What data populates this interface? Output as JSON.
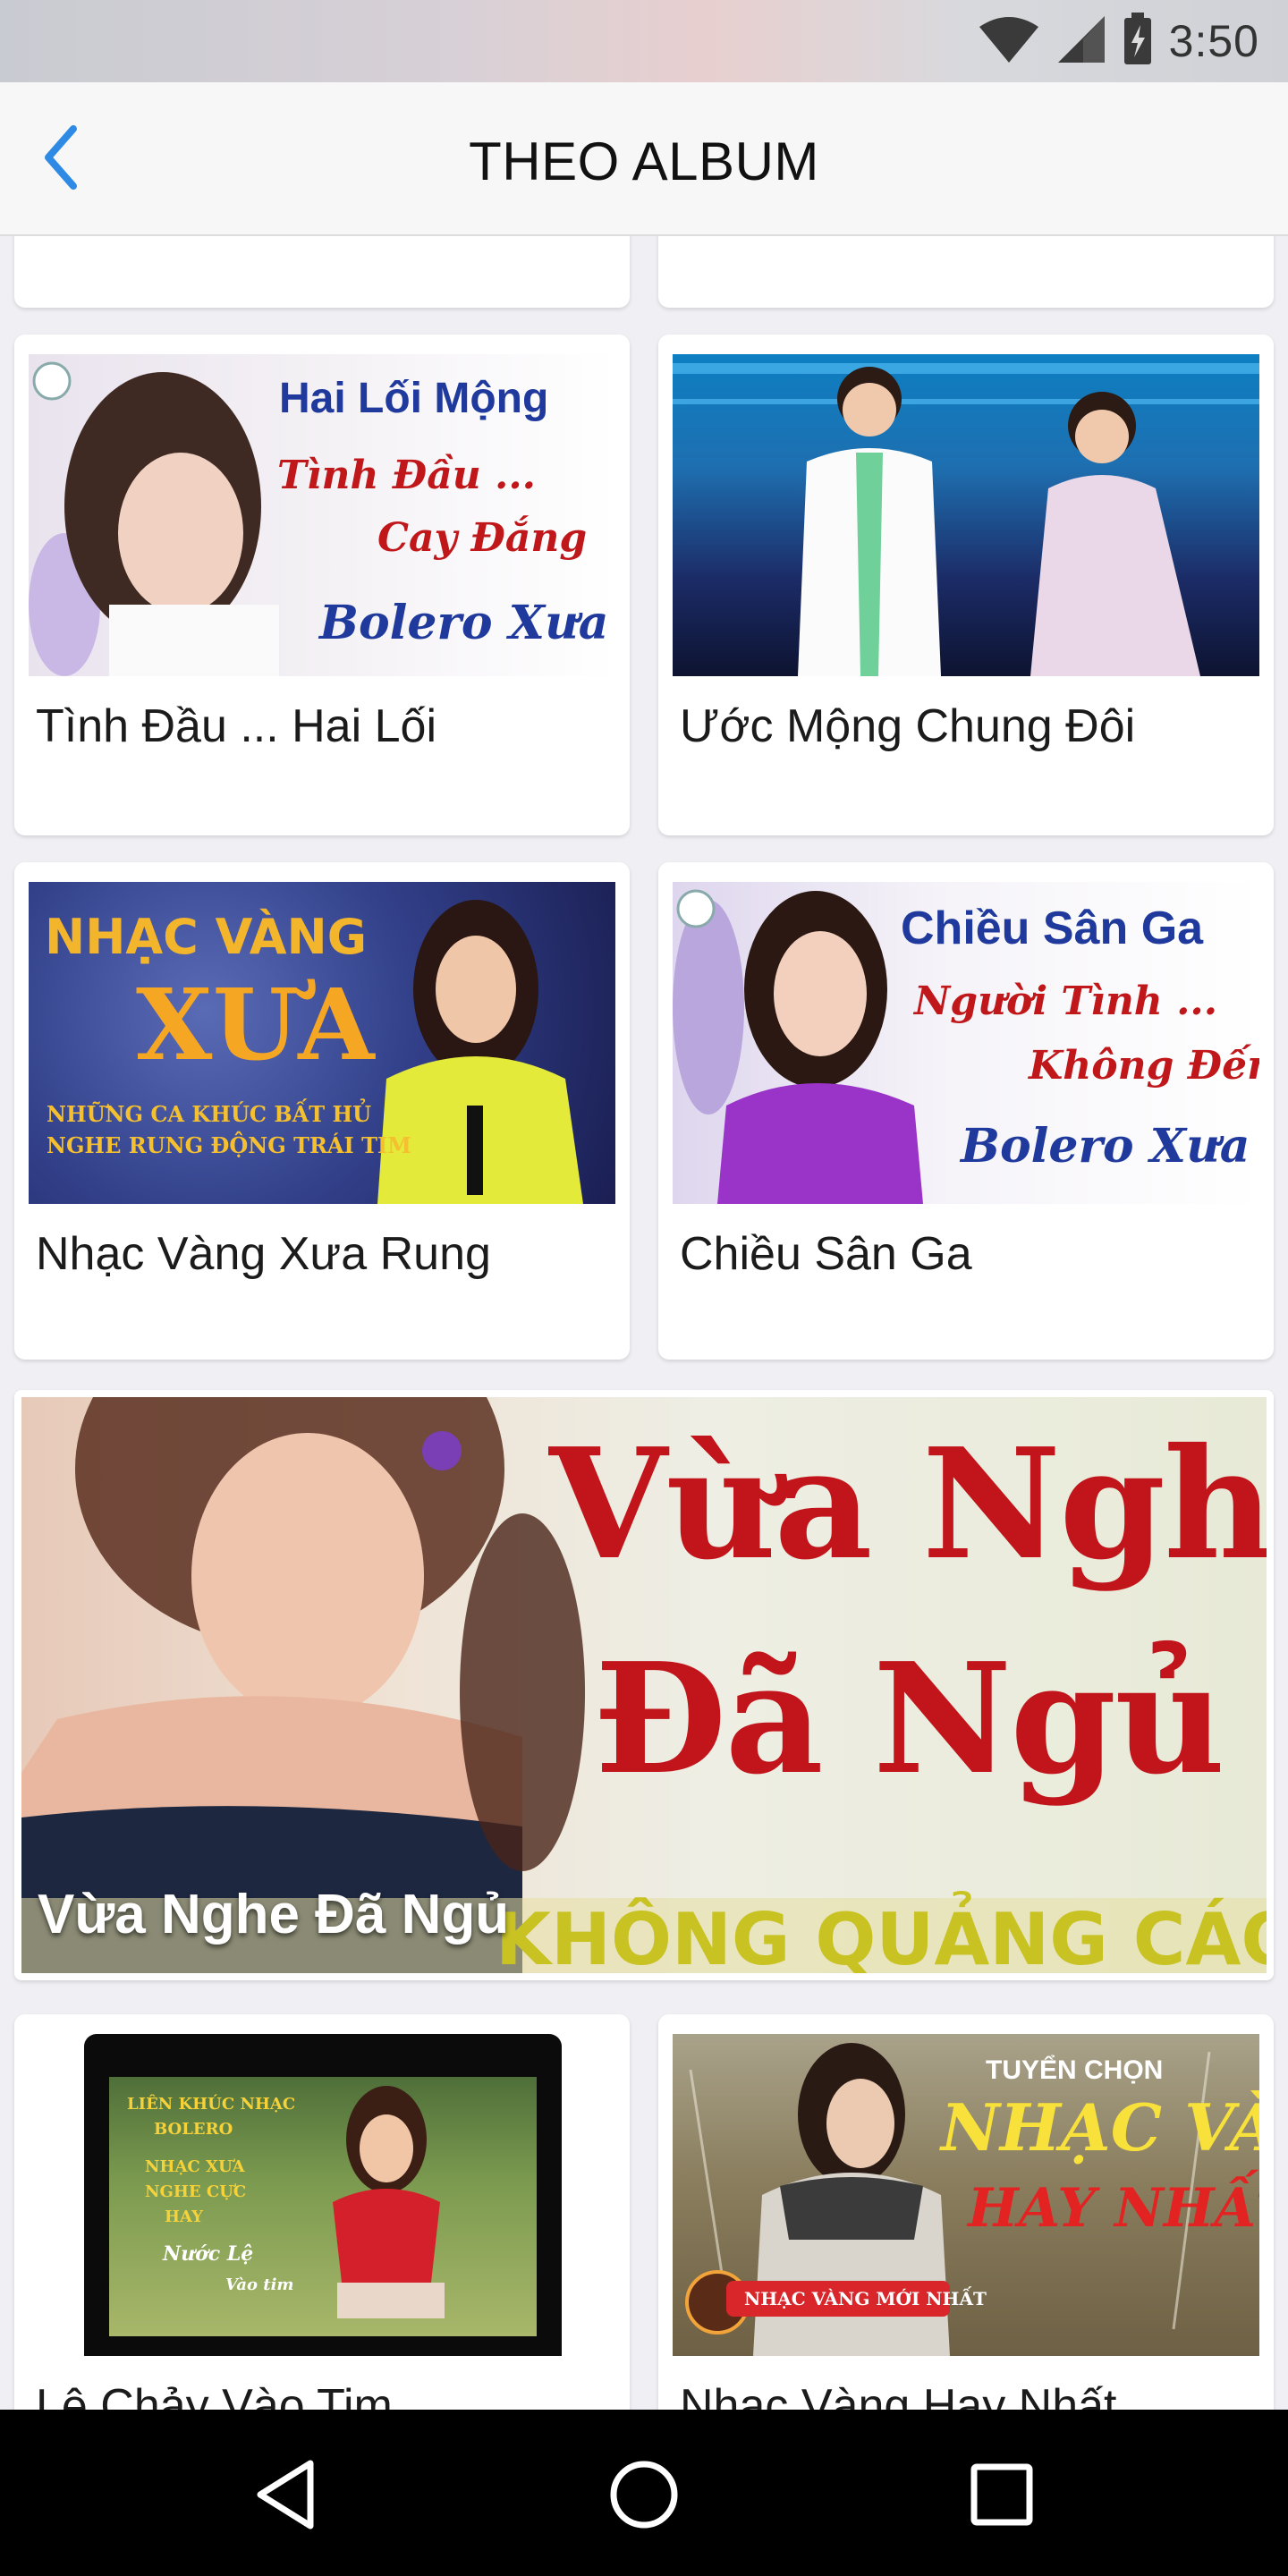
{
  "status_bar": {
    "time": "3:50",
    "icons": [
      "wifi-icon",
      "cell-signal-icon",
      "battery-icon"
    ]
  },
  "nav_bar": {
    "title": "THEO ALBUM",
    "back_icon": "chevron-left-icon",
    "accent": "#2f8ae5"
  },
  "albums": [
    {
      "title": "Tình Đầu ... Hai Lối",
      "thumb_text": [
        "Hai Lối Mộng",
        "Tình Đầu ...",
        "Cay Đắng",
        "Bolero Xưa"
      ]
    },
    {
      "title": "Ước Mộng Chung Đôi",
      "thumb_text": []
    },
    {
      "title": "Nhạc Vàng Xưa Rung",
      "thumb_text": [
        "NHẠC VÀNG",
        "XƯA",
        "NHỮNG CA KHÚC BẤT HỦ",
        "NGHE RUNG ĐỘNG TRÁI TIM"
      ]
    },
    {
      "title": "Chiều Sân Ga",
      "thumb_text": [
        "Chiều Sân Ga",
        "Người Tình ...",
        "Không Đến",
        "Bolero Xưa"
      ]
    }
  ],
  "banner": {
    "title": "Vừa Nghe Đã Ngủ",
    "thumb_text": [
      "Vừa Nghe",
      "Đã Ngủ",
      "KHÔNG QUẢNG CÁO"
    ]
  },
  "albums_bottom": [
    {
      "title": "Lệ Chảy Vào Tim",
      "thumb_text": [
        "LIÊN KHÚC NHẠC",
        "BOLERO",
        "NHẠC XƯA",
        "NGHE CỰC",
        "HAY",
        "Nước Lệ",
        "Vào tim"
      ]
    },
    {
      "title": "Nhạc Vàng Hay Nhất",
      "thumb_text": [
        "TUYỂN CHỌN",
        "NHẠC VÀNG",
        "HAY NHẤT",
        "NHẠC VÀNG MỚI NHẤT"
      ]
    }
  ],
  "system_nav": {
    "buttons": [
      "back-triangle-icon",
      "home-circle-icon",
      "recents-square-icon"
    ]
  }
}
